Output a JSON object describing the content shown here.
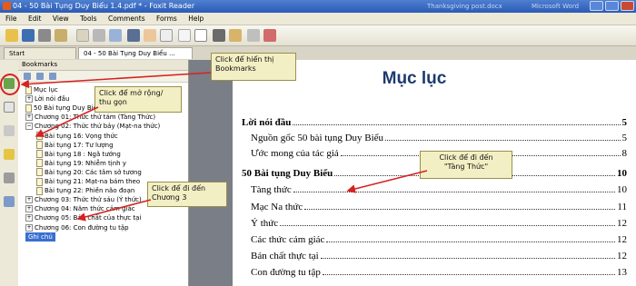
{
  "window": {
    "title": "04 - 50 Bài Tụng Duy Biểu 1.4.pdf * - Foxit Reader",
    "ghost_left": "Thanksgiving post.docx",
    "ghost_right": "Microsoft Word"
  },
  "menu": [
    "File",
    "Edit",
    "View",
    "Tools",
    "Comments",
    "Forms",
    "Help"
  ],
  "tabs": {
    "start": "Start",
    "document": "04 - 50 Bài Tụng Duy Biểu ..."
  },
  "bookmarks": {
    "header": "Bookmarks",
    "items": [
      {
        "label": "Mục lục",
        "type": "leaf",
        "level": 1
      },
      {
        "label": "Lời nói đầu",
        "type": "collapsed",
        "level": 1
      },
      {
        "label": "50 Bài tụng Duy Biểu",
        "type": "leaf",
        "level": 1
      },
      {
        "label": "Chương 01: Thức thứ tám (Tàng Thức)",
        "type": "collapsed",
        "level": 1
      },
      {
        "label": "Chương 02: Thức thứ bảy (Mạt-na thức)",
        "type": "expanded",
        "level": 1
      },
      {
        "label": "Bài tụng 16: Vọng thức",
        "type": "leaf",
        "level": 2
      },
      {
        "label": "Bài tụng 17: Tư lượng",
        "type": "leaf",
        "level": 2
      },
      {
        "label": "Bài tụng 18 : Ngã tướng",
        "type": "leaf",
        "level": 2
      },
      {
        "label": "Bài tụng 19: Nhiễm tịnh y",
        "type": "leaf",
        "level": 2
      },
      {
        "label": "Bài tụng 20: Các tâm sở tương",
        "type": "leaf",
        "level": 2
      },
      {
        "label": "Bài tụng 21: Mạt-na bám theo",
        "type": "leaf",
        "level": 2
      },
      {
        "label": "Bài tụng 22: Phiền não đoạn",
        "type": "leaf",
        "level": 2
      },
      {
        "label": "Chương 03: Thức thứ sáu (Ý thức)",
        "type": "collapsed",
        "level": 1
      },
      {
        "label": "Chương 04: Năm thức cảm giác",
        "type": "collapsed",
        "level": 1
      },
      {
        "label": "Chương 05: Bản chất của thực tại",
        "type": "collapsed",
        "level": 1
      },
      {
        "label": "Chương 06: Con đường tu tập",
        "type": "collapsed",
        "level": 1
      },
      {
        "label": "Ghi chú",
        "type": "selected",
        "level": 1
      }
    ]
  },
  "document": {
    "title": "Mục lục",
    "entries": [
      {
        "text": "Lời nói đầu",
        "page": "5",
        "bold": true,
        "indent": 0
      },
      {
        "text": "Nguồn gốc 50 bài tụng Duy Biểu",
        "page": "5",
        "bold": false,
        "indent": 1
      },
      {
        "text": "Ước mong của tác giả",
        "page": "8",
        "bold": false,
        "indent": 1
      },
      {
        "text": "50 Bài tụng Duy Biểu",
        "page": "10",
        "bold": true,
        "indent": 0
      },
      {
        "text": "Tàng thức",
        "page": "10",
        "bold": false,
        "indent": 1
      },
      {
        "text": "Mạc Na thức",
        "page": "11",
        "bold": false,
        "indent": 1
      },
      {
        "text": "Ý thức",
        "page": "12",
        "bold": false,
        "indent": 1
      },
      {
        "text": "Các thức cảm giác",
        "page": "12",
        "bold": false,
        "indent": 1
      },
      {
        "text": "Bản chất thực tại",
        "page": "12",
        "bold": false,
        "indent": 1
      },
      {
        "text": "Con đường tu tập",
        "page": "13",
        "bold": false,
        "indent": 1
      }
    ]
  },
  "callouts": {
    "bookmarks": "Click để hiển thị\nBookmarks",
    "expand": "Click để mở rộng/\nthu gọn",
    "chapter": "Click để đi đến\nChương 3",
    "tang_thuc": "Click để đi đến\n\"Tàng Thức\""
  },
  "colors": {
    "callout_bg": "#f3efc4",
    "arrow": "#d62222",
    "title_blue": "#1e3a6e",
    "selection": "#3a6ed0"
  }
}
